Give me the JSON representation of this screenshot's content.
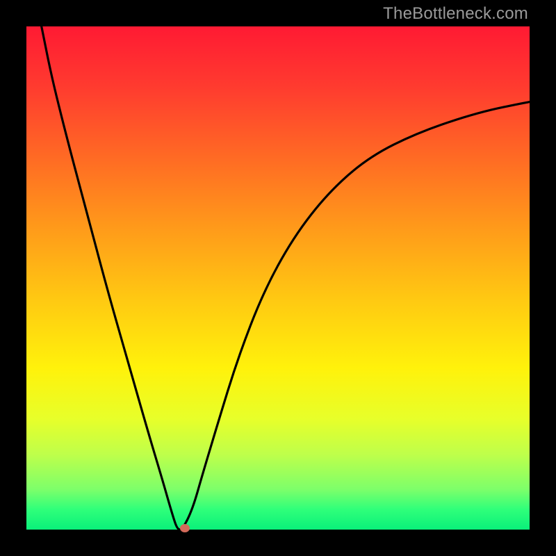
{
  "watermark": "TheBottleneck.com",
  "chart_data": {
    "type": "line",
    "title": "",
    "xlabel": "",
    "ylabel": "",
    "xlim": [
      0,
      100
    ],
    "ylim": [
      0,
      100
    ],
    "grid": false,
    "legend": false,
    "series": [
      {
        "name": "curve",
        "x": [
          3,
          5,
          8,
          12,
          16,
          20,
          24,
          27,
          29,
          30,
          31,
          33,
          35,
          38,
          42,
          47,
          53,
          60,
          68,
          78,
          90,
          100
        ],
        "y": [
          100,
          90,
          78,
          63,
          48,
          34,
          20,
          10,
          3,
          0,
          0,
          4,
          11,
          21,
          34,
          47,
          58,
          67,
          74,
          79,
          83,
          85
        ]
      }
    ],
    "marker": {
      "x": 31.5,
      "y": 0
    },
    "colors": {
      "curve": "#000000",
      "marker": "#d36a5a",
      "gradient_top": "#ff1a33",
      "gradient_bottom": "#0af07a",
      "frame": "#000000"
    }
  }
}
